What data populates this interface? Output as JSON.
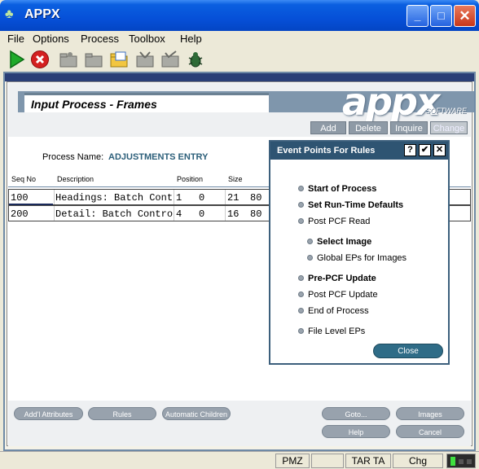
{
  "window": {
    "title": "APPX",
    "app_icon": "appx-tree-icon",
    "minimize": "_",
    "maximize": "□",
    "close": "✕"
  },
  "menu": [
    "File",
    "Options",
    "Process",
    "Toolbox",
    "Help"
  ],
  "toolbar": [
    "run-icon",
    "stop-icon",
    "folder-gear-icon",
    "folder-icon",
    "folder-open-icon",
    "folder-tools-icon",
    "folder-check-icon",
    "bug-icon"
  ],
  "header": {
    "process_title": "Input Process - Frames",
    "logo": "appx",
    "logo_sub": "SOFTWARE"
  },
  "modes": [
    "Add",
    "Delete",
    "Inquire",
    "Change"
  ],
  "process": {
    "label": "Process Name:",
    "value": "ADJUSTMENTS ENTRY"
  },
  "table": {
    "columns": [
      "Seq No",
      "Description",
      "Position",
      "Size"
    ],
    "rows": [
      {
        "seq": "100",
        "desc": "Headings: Batch Cont",
        "pos1": "1",
        "pos2": "0",
        "size1": "21",
        "size2": "80"
      },
      {
        "seq": "200",
        "desc": "Detail: Batch Contro",
        "pos1": "4",
        "pos2": "0",
        "size1": "16",
        "size2": "80"
      }
    ]
  },
  "dialog": {
    "title": "Event Points For Rules",
    "help": "?",
    "ok": "✔",
    "close_x": "✕",
    "items": [
      {
        "label": "Start of Process",
        "bold": true
      },
      {
        "label": "Set Run-Time Defaults",
        "bold": true
      },
      {
        "label": "Post PCF Read",
        "bold": false
      },
      {
        "label": "Select Image",
        "bold": true
      },
      {
        "label": "Global EPs for Images",
        "bold": false
      },
      {
        "label": "Pre-PCF Update",
        "bold": true
      },
      {
        "label": "Post PCF Update",
        "bold": false
      },
      {
        "label": "End of Process",
        "bold": false
      },
      {
        "label": "File Level EPs",
        "bold": false
      }
    ],
    "close_button": "Close"
  },
  "bottom_buttons": {
    "addl_attributes": "Add'l Attributes",
    "rules": "Rules",
    "automatic_children": "Automatic Children",
    "goto": "Goto...",
    "images": "Images",
    "help": "Help",
    "cancel": "Cancel"
  },
  "status": {
    "s1": "PMZ",
    "s2": "",
    "s3": "TAR TA",
    "s4": "Chg"
  },
  "colors": {
    "title_bar": "#0650d8",
    "dialog_title": "#2e5472",
    "accent": "#2c5f7a"
  }
}
